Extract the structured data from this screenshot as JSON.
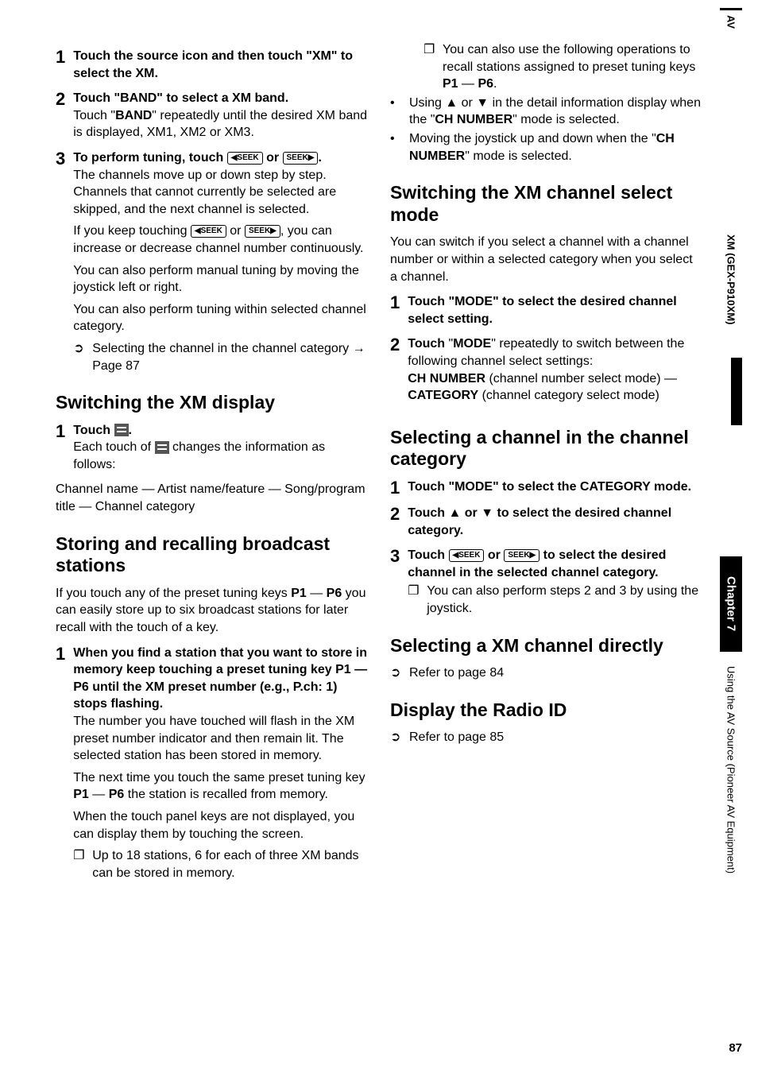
{
  "left": {
    "step1_lead": "Touch the source icon and then touch \"XM\" to select the XM.",
    "step2_lead": "Touch \"BAND\" to select a XM band.",
    "step2_body": "Touch \"",
    "step2_body_b": "BAND",
    "step2_body2": "\" repeatedly until the desired XM band is displayed, XM1, XM2 or XM3.",
    "step3_lead_a": "To perform tuning, touch ",
    "step3_lead_b": " or ",
    "step3_lead_c": ".",
    "step3_p1": "The channels move up or down step by step. Channels that cannot currently be selected are skipped, and the next channel is selected.",
    "step3_p2a": "If you keep touching ",
    "step3_p2b": " or ",
    "step3_p2c": ", you can increase or decrease channel number continuously.",
    "step3_p3": "You can also perform manual tuning by moving the joystick left or right.",
    "step3_p4": "You can also perform tuning within selected channel category.",
    "step3_link_a": "Selecting the channel in the channel category ",
    "step3_link_b": " Page 87",
    "h_swdisp": "Switching the XM display",
    "swdisp_step1_lead_a": "Touch ",
    "swdisp_step1_lead_b": ".",
    "swdisp_p1a": "Each touch of ",
    "swdisp_p1b": " changes the information as follows:",
    "swdisp_p2": "Channel name — Artist name/feature — Song/program title — Channel category",
    "h_store": "Storing and recalling broadcast stations",
    "store_intro_a": "If you touch any of the preset tuning keys ",
    "store_intro_b": "P1",
    "store_intro_c": " — ",
    "store_intro_d": "P6",
    "store_intro_e": " you can easily store up to six broadcast stations for later recall with the touch of a key.",
    "store_s1_lead": "When you find a station that you want to store in memory keep touching a preset tuning key P1 — P6 until the XM preset number (e.g., P.ch: 1) stops flashing.",
    "store_s1_p1": "The number you have touched will flash in the XM preset number indicator and then remain lit. The selected station has been stored in memory.",
    "store_s1_p2a": "The next time you touch the same preset tuning key ",
    "store_s1_p2b": "P1",
    "store_s1_p2c": " — ",
    "store_s1_p2d": "P6",
    "store_s1_p2e": " the station is recalled from memory.",
    "store_s1_p3": "When the touch panel keys are not displayed, you can display them by touching the screen.",
    "store_note1": "Up to 18 stations, 6 for each of three XM bands can be stored in memory."
  },
  "right": {
    "cont_note_a": "You can also use the following operations to recall stations assigned to preset tuning keys ",
    "cont_note_b": "P1",
    "cont_note_c": " — ",
    "cont_note_d": "P6",
    "cont_note_e": ".",
    "cont_b1a": "Using ▲ or ▼ in the detail information display when the \"",
    "cont_b1b": "CH NUMBER",
    "cont_b1c": "\" mode is selected.",
    "cont_b2a": "Moving the joystick up and down when the \"",
    "cont_b2b": "CH NUMBER",
    "cont_b2c": "\" mode is selected.",
    "h_swmode": "Switching the XM channel select mode",
    "swmode_intro": "You can switch if you select a channel with a channel number or within a selected category when you select a channel.",
    "swmode_s1_lead": "Touch \"MODE\" to select the desired channel select setting.",
    "swmode_s2_a": "Touch",
    "swmode_s2_b": " \"",
    "swmode_s2_c": "MODE",
    "swmode_s2_d": "\" repeatedly to switch between the following channel select settings:",
    "swmode_s2_l1a": "CH NUMBER",
    "swmode_s2_l1b": " (channel number select mode) — ",
    "swmode_s2_l2a": "CATEGORY",
    "swmode_s2_l2b": " (channel category select mode)",
    "h_selcat": "Selecting a channel in the channel category",
    "selcat_s1_lead": "Touch \"MODE\" to select the CATEGORY mode.",
    "selcat_s2_lead": "Touch ▲ or ▼ to select the desired channel category.",
    "selcat_s3_lead_a": "Touch ",
    "selcat_s3_lead_b": " or ",
    "selcat_s3_lead_c": " to select the desired channel in the selected channel category.",
    "selcat_note": "You can also perform steps 2 and 3 by using the joystick.",
    "h_seldirect": "Selecting a XM channel directly",
    "seldirect_link": "Refer to page 84",
    "h_radioid": "Display the Radio ID",
    "radioid_link": "Refer to page 85"
  },
  "side": {
    "av": "AV",
    "section": "XM (GEX-P910XM)",
    "chapter": "Chapter 7",
    "using": "Using the AV Source (Pioneer AV Equipment)"
  },
  "pagenum": "87",
  "icons": {
    "seek_prev": "◀SEEK",
    "seek_next": "SEEK▶"
  }
}
